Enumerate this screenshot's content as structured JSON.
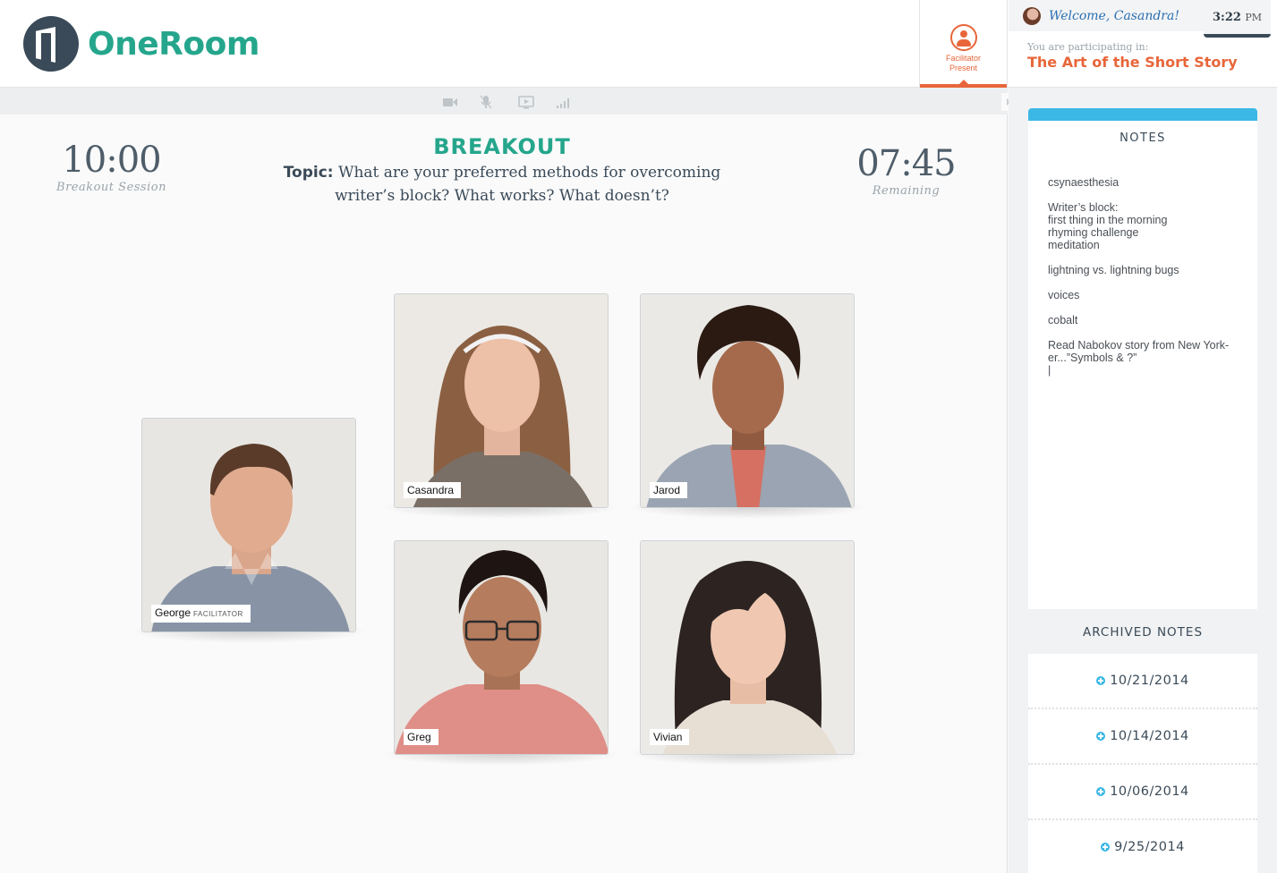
{
  "app": {
    "name": "OneRoom"
  },
  "header": {
    "facilitator_status": [
      "Facilitator",
      "Present"
    ],
    "welcome": "Welcome, Casandra!",
    "time": "3:22",
    "ampm": "PM",
    "participating_label": "You are  participating in:",
    "course_title": "The Art of the Short Story"
  },
  "toolbar": {
    "icons": [
      "video-camera-icon",
      "microphone-icon",
      "screen-share-icon",
      "signal-strength-icon"
    ]
  },
  "session": {
    "session_length": "10:00",
    "session_label": "Breakout Session",
    "remaining": "07:45",
    "remaining_label": "Remaining",
    "title": "BREAKOUT",
    "topic_label": "Topic:",
    "topic_text": " What are your preferred methods for overcoming writer’s block? What works? What doesn’t?"
  },
  "participants": [
    {
      "name": "George",
      "role": "Facilitator"
    },
    {
      "name": "Casandra",
      "role": ""
    },
    {
      "name": "Jarod",
      "role": ""
    },
    {
      "name": "Greg",
      "role": ""
    },
    {
      "name": "Vivian",
      "role": ""
    }
  ],
  "notes": {
    "title": "NOTES",
    "entries": [
      "csynaesthesia",
      "Writer’s block:\nfirst thing in the morning\nrhyming challenge\nmeditation",
      "lightning vs. lightning bugs",
      "voices",
      "cobalt",
      "Read Nabokov story from New York-\ner...”Symbols & ?”\n|"
    ]
  },
  "archived_notes": {
    "title": "ARCHIVED NOTES",
    "dates": [
      "10/21/2014",
      "10/14/2014",
      "10/06/2014",
      "9/25/2014"
    ]
  },
  "colors": {
    "brand_teal": "#25a68c",
    "accent_orange": "#e8663a",
    "accent_blue": "#3bb8e6",
    "slate": "#3a4a58"
  }
}
